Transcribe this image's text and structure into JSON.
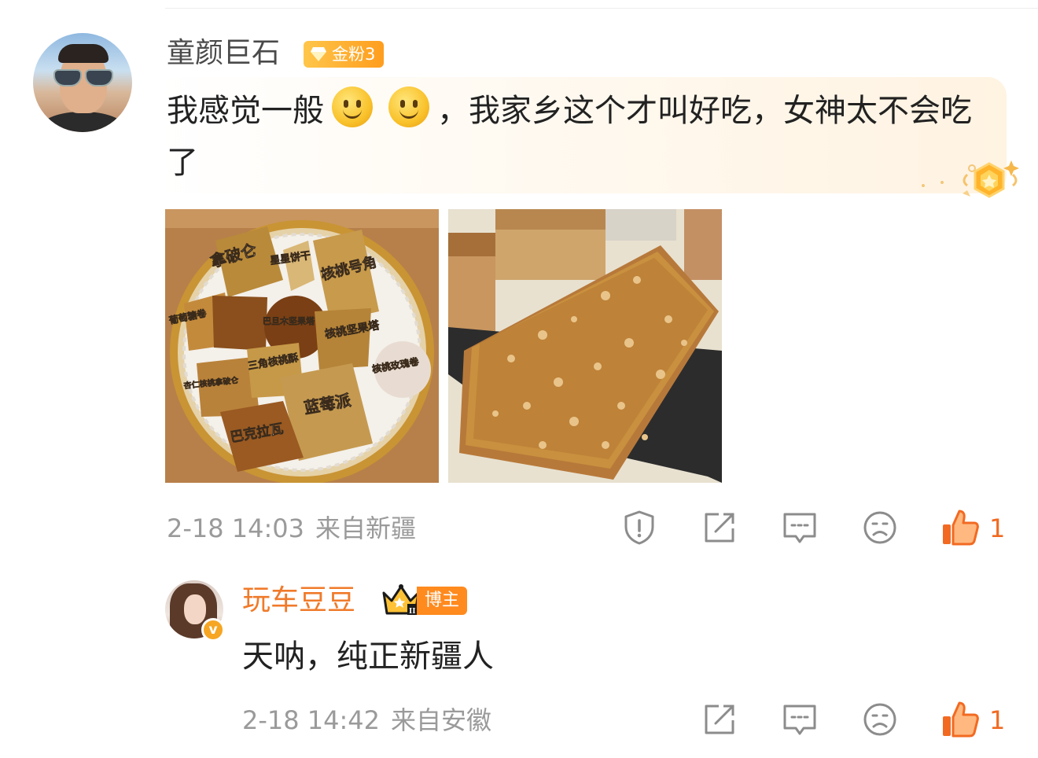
{
  "comment": {
    "username": "童颜巨石",
    "fan_badge": "金粉3",
    "text_part1": "我感觉一般",
    "text_part2": "，我家乡这个才叫好吃，女神太不会吃了",
    "emojis": [
      "smile-emoji",
      "smile-emoji"
    ],
    "photos": [
      {
        "labels": [
          "拿破仑",
          "星星饼干",
          "核桃号角",
          "葡萄糖卷",
          "巴旦木坚果塔",
          "核桃坚果塔",
          "三角核桃酥",
          "核桃玫瑰卷",
          "杏仁核桃拿破仑",
          "蓝莓派",
          "巴克拉瓦"
        ]
      },
      {
        "labels": []
      }
    ],
    "timestamp": "2-18 14:03",
    "location": "来自新疆",
    "actions": [
      "report-icon",
      "share-icon",
      "comment-icon",
      "dislike-icon",
      "like-icon"
    ],
    "like_count": "1"
  },
  "reply": {
    "username": "玩车豆豆",
    "host_badge": "博主",
    "verified_mark": "v",
    "text": "天呐，纯正新疆人",
    "timestamp": "2-18 14:42",
    "location": "来自安徽",
    "actions": [
      "share-icon",
      "comment-icon",
      "dislike-icon",
      "like-icon"
    ],
    "like_count": "1"
  },
  "colors": {
    "accent": "#f07a2a",
    "meta_gray": "#9a9a9a",
    "badge_gold": "#ffb73a"
  }
}
